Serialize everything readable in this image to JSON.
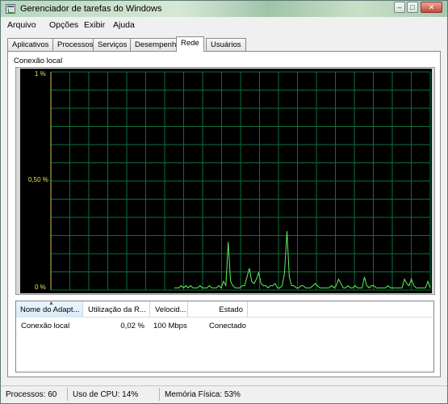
{
  "window": {
    "title": "Gerenciador de tarefas do Windows",
    "controls": {
      "minimize": "–",
      "maximize": "□",
      "close": "✕"
    }
  },
  "menu": [
    "Arquivo",
    "Opções",
    "Exibir",
    "Ajuda"
  ],
  "tabs": [
    "Aplicativos",
    "Processos",
    "Serviços",
    "Desempenho",
    "Rede",
    "Usuários"
  ],
  "active_tab": "Rede",
  "network": {
    "group_label": "Conexão local",
    "y_axis": {
      "top": "1 %",
      "middle": "0,50 %",
      "bottom": "0 %"
    },
    "colors": {
      "background": "#000000",
      "grid": "#0b6f3a",
      "line": "#5bf15b",
      "axis_label": "#e7e74c"
    },
    "chart_data": {
      "type": "line",
      "title": "",
      "xlabel": "",
      "ylabel": "",
      "ylim": [
        0,
        1
      ],
      "grid": true,
      "series": [
        {
          "values": [
            0.01,
            0.01,
            0.01,
            0.02,
            0.01,
            0.02,
            0.01,
            0.02,
            0.01,
            0.01,
            0.01,
            0.02,
            0.01,
            0.01,
            0.01,
            0.02,
            0.01,
            0.01,
            0.01,
            0.02,
            0.01,
            0.04,
            0.02,
            0.22,
            0.04,
            0.02,
            0.01,
            0.01,
            0.01,
            0.02,
            0.02,
            0.06,
            0.1,
            0.04,
            0.03,
            0.05,
            0.08,
            0.03,
            0.02,
            0.02,
            0.01,
            0.02,
            0.02,
            0.03,
            0.01,
            0.01,
            0.02,
            0.08,
            0.27,
            0.06,
            0.02,
            0.02,
            0.01,
            0.01,
            0.02,
            0.02,
            0.01,
            0.01,
            0.01,
            0.02,
            0.03,
            0.02,
            0.01,
            0.01,
            0.01,
            0.01,
            0.01,
            0.02,
            0.01,
            0.02,
            0.05,
            0.03,
            0.01,
            0.01,
            0.02,
            0.01,
            0.01,
            0.02,
            0.01,
            0.01,
            0.01,
            0.06,
            0.02,
            0.01,
            0.02,
            0.02,
            0.01,
            0.01,
            0.01,
            0.01,
            0.01,
            0.02,
            0.01,
            0.01,
            0.01,
            0.01,
            0.01,
            0.01,
            0.05,
            0.03,
            0.02,
            0.05,
            0.02,
            0.01,
            0.01,
            0.01,
            0.01,
            0.01,
            0.04,
            0.01
          ]
        }
      ]
    }
  },
  "adapter_table": {
    "columns": [
      "Nome do Adapt...",
      "Utilização da R...",
      "Velocid...",
      "Estado"
    ],
    "rows": [
      {
        "name": "Conexão local",
        "utilization": "0,02 %",
        "speed": "100 Mbps",
        "state": "Conectado"
      }
    ]
  },
  "statusbar": {
    "processes": "Processos: 60",
    "cpu": "Uso de CPU: 14%",
    "memory": "Memória Física: 53%"
  }
}
